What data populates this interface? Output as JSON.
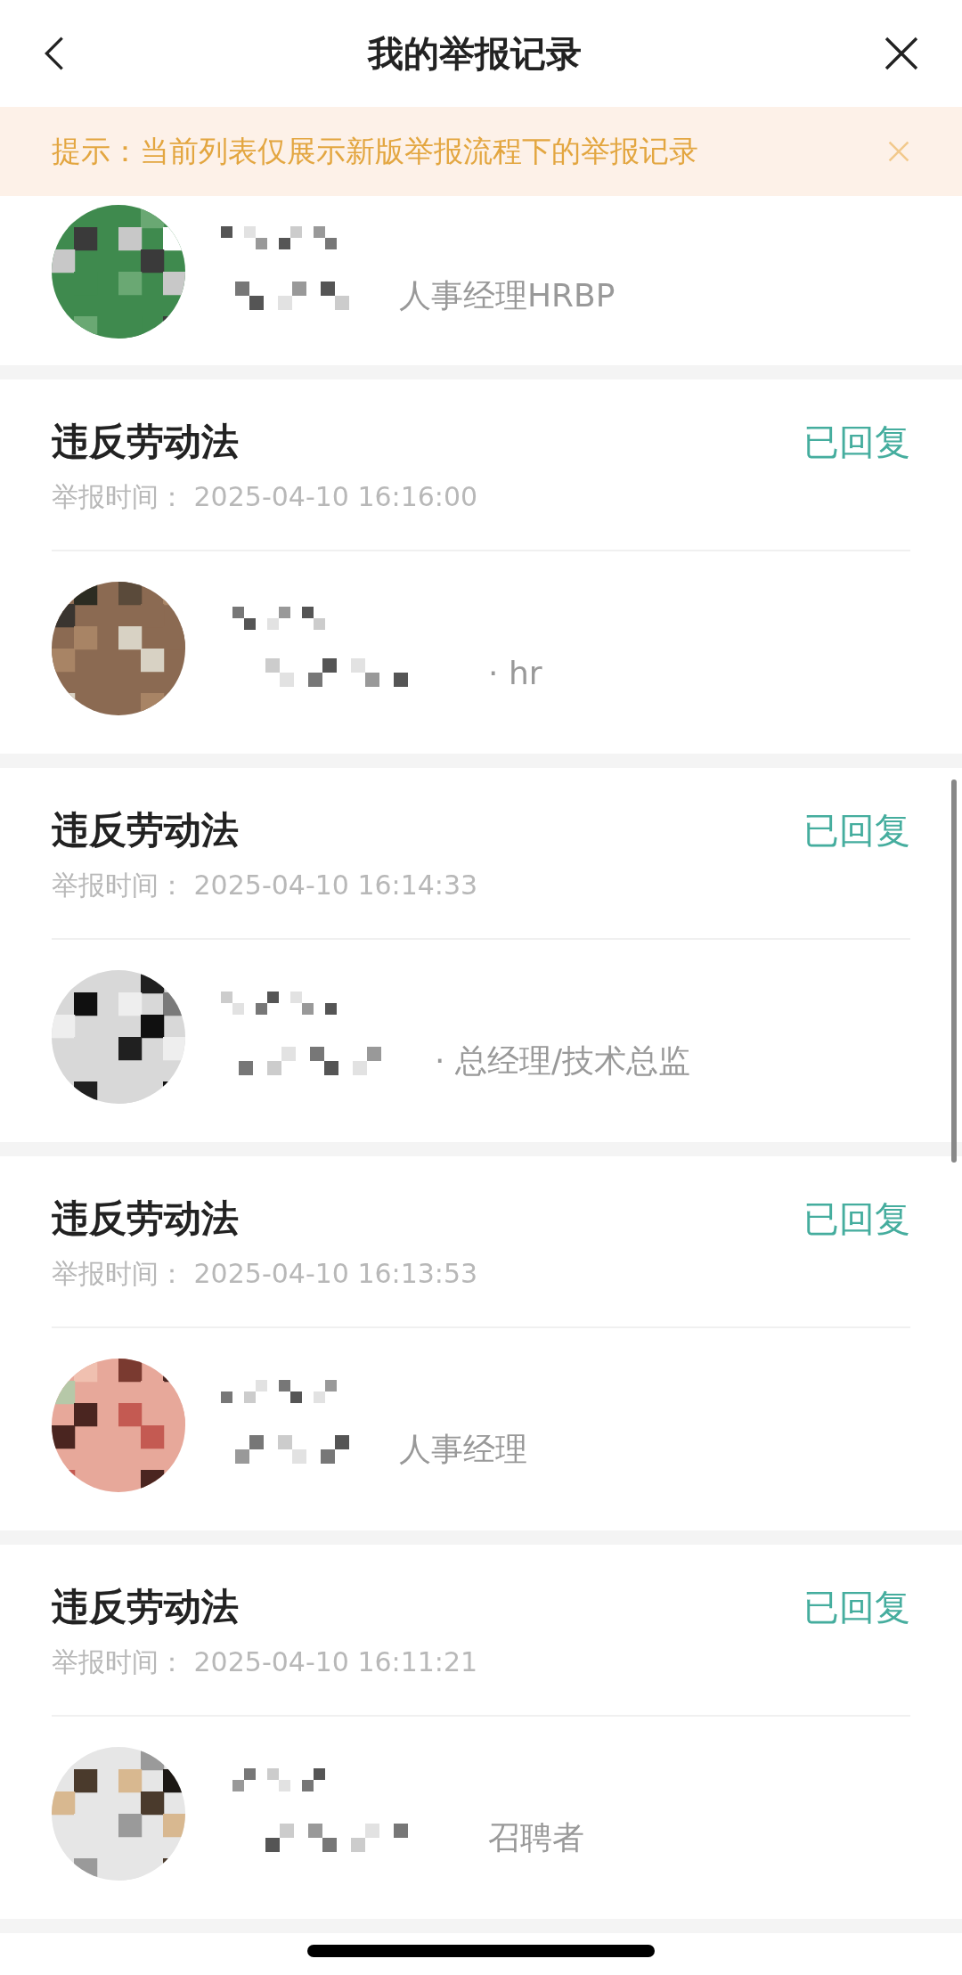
{
  "header": {
    "title": "我的举报记录"
  },
  "notice": {
    "text": "提示：当前列表仅展示新版举报流程下的举报记录"
  },
  "records": [
    {
      "kind": "cut-top",
      "role": "人事经理HRBP"
    },
    {
      "kind": "full",
      "title": "违反劳动法",
      "status": "已回复",
      "time": "举报时间： 2025-04-10 16:16:00",
      "role": "· hr"
    },
    {
      "kind": "full",
      "title": "违反劳动法",
      "status": "已回复",
      "time": "举报时间： 2025-04-10 16:14:33",
      "role": "· 总经理/技术总监"
    },
    {
      "kind": "full",
      "title": "违反劳动法",
      "status": "已回复",
      "time": "举报时间： 2025-04-10 16:13:53",
      "role": "人事经理"
    },
    {
      "kind": "full",
      "title": "违反劳动法",
      "status": "已回复",
      "time": "举报时间： 2025-04-10 16:11:21",
      "role": "召聘者"
    },
    {
      "kind": "cut-bottom"
    }
  ]
}
